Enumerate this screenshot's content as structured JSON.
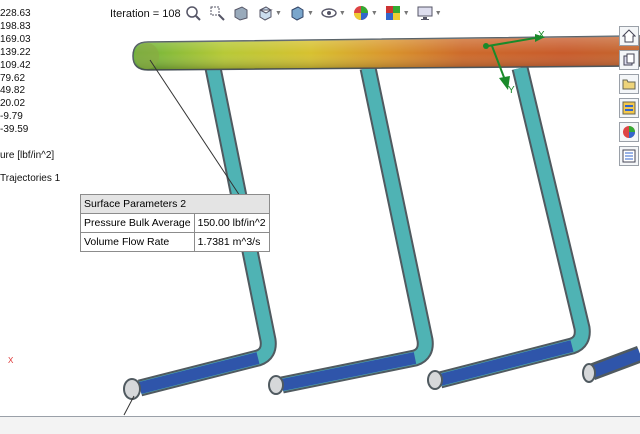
{
  "legend": {
    "values": [
      "228.63",
      "198.83",
      "169.03",
      "139.22",
      "109.42",
      "79.62",
      "49.82",
      "20.02",
      "-9.79",
      "-39.59"
    ],
    "title": "ure [lbf/in^2]",
    "trajectories": "Trajectories 1"
  },
  "iteration": "Iteration = 108",
  "toolbar": {
    "icons": [
      "zoom-to-fit-icon",
      "zoom-area-icon",
      "section-view-icon",
      "view-orientation-icon",
      "display-style-icon",
      "hide-show-icon",
      "edit-appearance-icon",
      "scene-icon",
      "view-settings-icon"
    ]
  },
  "parameters_table": {
    "title": "Surface Parameters 2",
    "rows": [
      {
        "label": "Pressure Bulk Average",
        "value": "150.00 lbf/in^2"
      },
      {
        "label": "Volume Flow Rate",
        "value": "1.7381 m^3/s"
      }
    ]
  },
  "triad": {
    "x_label": "X",
    "y_label": "Y",
    "color": "#1a8a2a"
  },
  "corner_axis": {
    "x_label": "X",
    "color": "#d33333"
  },
  "side_panel": {
    "icons": [
      "home-icon",
      "parts-icon",
      "folder-icon",
      "view-palette-icon",
      "appearances-icon",
      "custom-properties-icon"
    ]
  }
}
